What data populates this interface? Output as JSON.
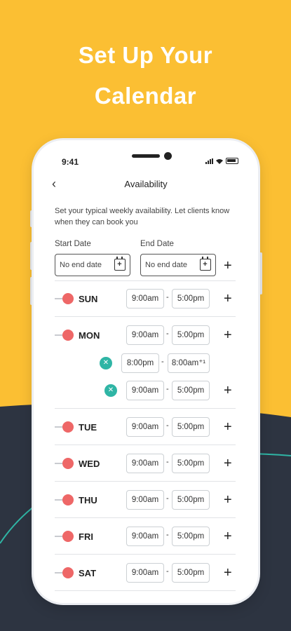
{
  "headline": {
    "line1": "Set Up Your",
    "line2": "Calendar"
  },
  "colors": {
    "background": "#FBBF33",
    "dark": "#2D3441",
    "accent_teal": "#2FB5A5",
    "toggle_red": "#EE6767"
  },
  "status_bar": {
    "time": "9:41"
  },
  "nav": {
    "back_icon": "chevron-left-icon",
    "title": "Availability"
  },
  "intro": "Set your typical weekly availability. Let clients know when they can book you",
  "start_date": {
    "label": "Start Date",
    "value": "No end date"
  },
  "end_date": {
    "label": "End Date",
    "value": "No end date"
  },
  "dash": "-",
  "days": [
    {
      "name": "SUN",
      "start": "9:00am",
      "end": "5:00pm"
    },
    {
      "name": "MON",
      "start": "9:00am",
      "end": "5:00pm",
      "extra": [
        {
          "start": "8:00pm",
          "end": "8:00am⁺¹"
        },
        {
          "start": "9:00am",
          "end": "5:00pm"
        }
      ]
    },
    {
      "name": "TUE",
      "start": "9:00am",
      "end": "5:00pm"
    },
    {
      "name": "WED",
      "start": "9:00am",
      "end": "5:00pm"
    },
    {
      "name": "THU",
      "start": "9:00am",
      "end": "5:00pm"
    },
    {
      "name": "FRI",
      "start": "9:00am",
      "end": "5:00pm"
    },
    {
      "name": "SAT",
      "start": "9:00am",
      "end": "5:00pm"
    }
  ]
}
